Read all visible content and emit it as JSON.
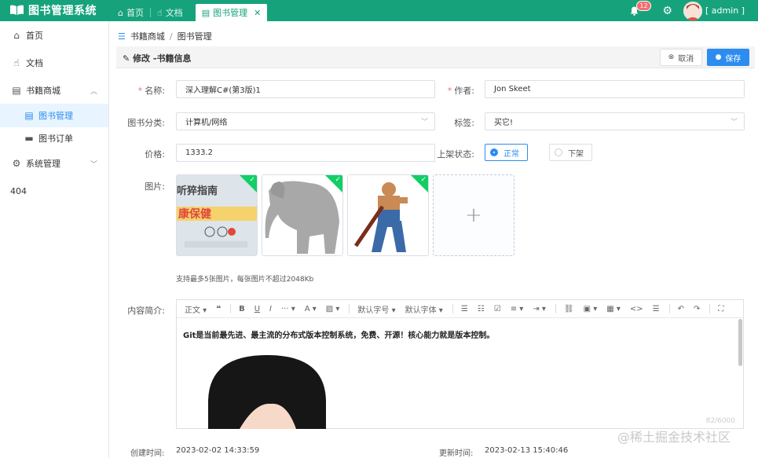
{
  "app": {
    "title": "图书管理系统"
  },
  "tabs": [
    {
      "label": "首页"
    },
    {
      "label": "文档"
    },
    {
      "label": "图书管理"
    }
  ],
  "topbar": {
    "badge_count": "12",
    "user": "[ admin ]"
  },
  "sidebar": {
    "items": [
      {
        "label": "首页"
      },
      {
        "label": "文档"
      },
      {
        "label": "书籍商城"
      },
      {
        "label": "图书管理"
      },
      {
        "label": "图书订单"
      },
      {
        "label": "系统管理"
      }
    ],
    "extra": "404"
  },
  "breadcrumb": [
    "书籍商城",
    "/",
    "图书管理"
  ],
  "card": {
    "title": "修改 -书籍信息",
    "cancel_label": "取消",
    "save_label": "保存"
  },
  "form": {
    "name_label": "名称:",
    "name_value": "深入理解C#(第3版)1",
    "author_label": "作者:",
    "author_value": "Jon Skeet",
    "category_label": "图书分类:",
    "category_value": "计算机/网络",
    "tag_label": "标签:",
    "tag_value": "买它!",
    "price_label": "价格:",
    "price_value": "1333.2",
    "status_label": "上架状态:",
    "status_on": "正常",
    "status_off": "下架",
    "image_label": "图片:",
    "image_tip": "支持最多5张图片，每张图片不超过2048Kb",
    "thumb1_text_a": "听猝指南",
    "thumb1_text_b": "康保健",
    "content_label": "内容简介:",
    "content_text": "Git是当前最先进、最主流的分布式版本控制系统，免费、开源！核心能力就是版本控制。",
    "counter": "82/6000",
    "created_label": "创建时间:",
    "created_value": "2023-02-02 14:33:59",
    "updated_label": "更新时间:",
    "updated_value": "2023-02-13 15:40:46"
  },
  "editor_toolbar": {
    "heading": "正文",
    "default_size": "默认字号",
    "default_font": "默认字体"
  },
  "watermark": "@稀土掘金技术社区",
  "colors": {
    "primary": "#16a37c",
    "accent": "#2d8cf0",
    "success": "#13ce66",
    "required": "#f56c6c"
  }
}
